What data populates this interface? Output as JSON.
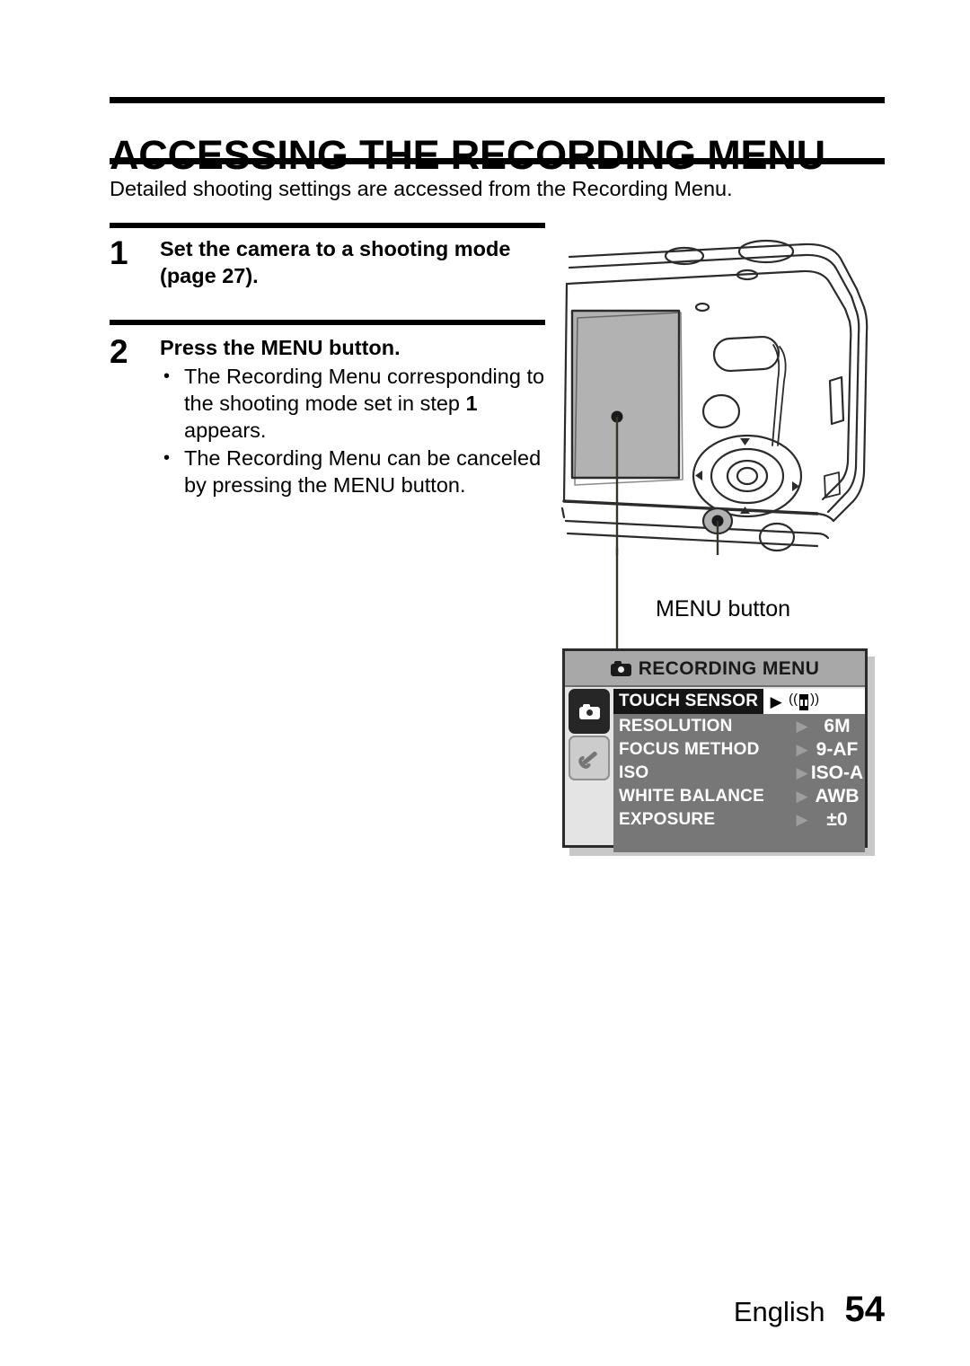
{
  "document": {
    "title": "ACCESSING THE RECORDING MENU",
    "intro": "Detailed shooting settings are accessed from the Recording Menu."
  },
  "steps": [
    {
      "number": "1",
      "heading": "Set the camera to a shooting mode (page 27).",
      "bullets": []
    },
    {
      "number": "2",
      "heading": "Press the MENU button.",
      "bullets": [
        {
          "part1": "The Recording Menu corresponding to the shooting mode set in step ",
          "emphasis": "1",
          "part2": " appears."
        },
        {
          "part1": "The Recording Menu can be canceled by pressing the MENU button.",
          "emphasis": "",
          "part2": ""
        }
      ]
    }
  ],
  "illustration": {
    "callout_label": "MENU button",
    "camera_icon_name": "camera-rear-illustration"
  },
  "osd": {
    "header_title": "RECORDING MENU",
    "header_icon": "camera-icon",
    "tabs": [
      {
        "name": "recording-tab",
        "icon": "camera-icon",
        "state": "active"
      },
      {
        "name": "setup-tab",
        "icon": "wrench-icon",
        "state": "inactive"
      }
    ],
    "rows": [
      {
        "label": "TOUCH SENSOR",
        "value": "",
        "value_icon": "touch-sensor-icon",
        "selected": true
      },
      {
        "label": "RESOLUTION",
        "value": "6M",
        "value_icon": "",
        "selected": false
      },
      {
        "label": "FOCUS METHOD",
        "value": "9-AF",
        "value_icon": "",
        "selected": false
      },
      {
        "label": "ISO",
        "value": "ISO-A",
        "value_icon": "",
        "selected": false
      },
      {
        "label": "WHITE BALANCE",
        "value": "AWB",
        "value_icon": "",
        "selected": false
      },
      {
        "label": "EXPOSURE",
        "value": "±0",
        "value_icon": "",
        "selected": false
      }
    ],
    "arrow_glyph": "▶",
    "colors": {
      "header_bg": "#a8a8a8",
      "list_bg": "#777777",
      "selected_label_bg": "#151515",
      "selected_value_bg": "#ffffff",
      "panel_border": "#2b2b2b"
    }
  },
  "footer": {
    "language": "English",
    "page_number": "54"
  }
}
